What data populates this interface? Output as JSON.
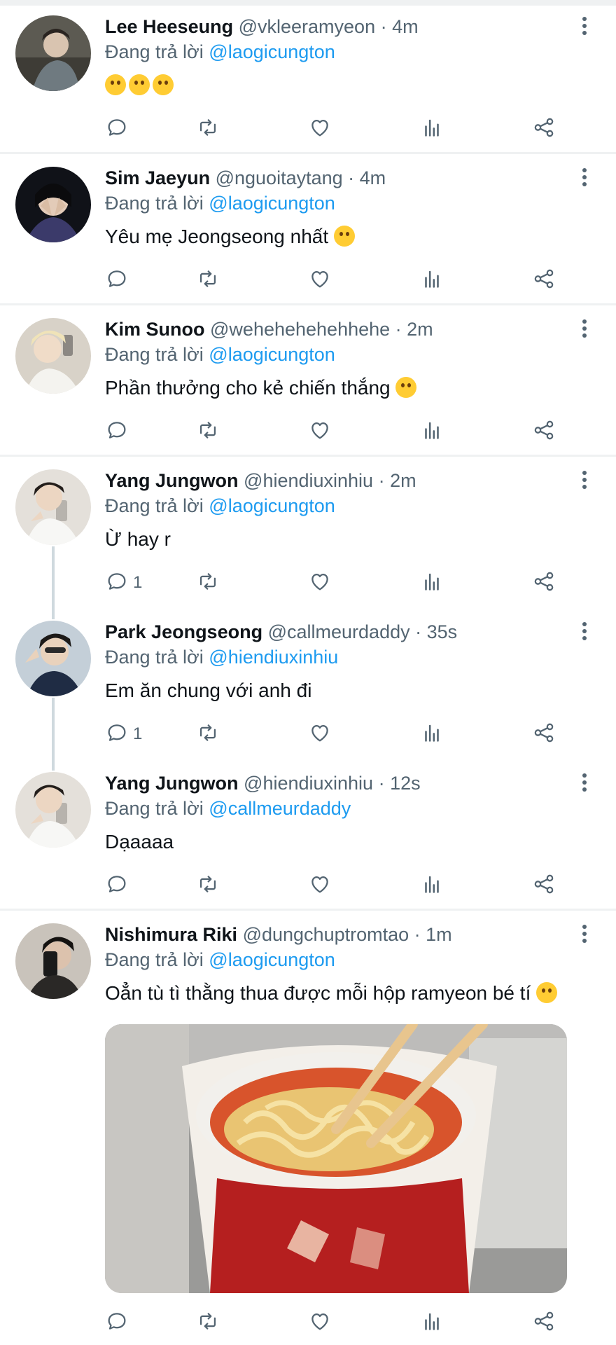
{
  "tweets": [
    {
      "name": "Lee Heeseung",
      "handle": "@vkleeramyeon",
      "time": "· 4m",
      "replying_prefix": "Đang trả lời",
      "replying_to": "@laogicungton",
      "text": "",
      "emoji_count": 3,
      "reply_count": ""
    },
    {
      "name": "Sim Jaeyun",
      "handle": "@nguoitaytang",
      "time": "· 4m",
      "replying_prefix": "Đang trả lời",
      "replying_to": "@laogicungton",
      "text": "Yêu mẹ Jeongseong nhất",
      "emoji_count": 1,
      "reply_count": ""
    },
    {
      "name": "Kim Sunoo",
      "handle": "@wehehehehehhehe",
      "time": "· 2m",
      "replying_prefix": "Đang trả lời",
      "replying_to": "@laogicungton",
      "text": "Phần thưởng cho kẻ chiến thắng",
      "emoji_count": 1,
      "reply_count": ""
    },
    {
      "name": "Yang Jungwon",
      "handle": "@hiendiuxinhiu",
      "time": "· 2m",
      "replying_prefix": "Đang trả lời",
      "replying_to": "@laogicungton",
      "text": "Ừ hay r",
      "emoji_count": 0,
      "reply_count": "1"
    },
    {
      "name": "Park Jeongseong",
      "handle": "@callmeurdaddy",
      "time": "· 35s",
      "replying_prefix": "Đang trả lời",
      "replying_to": "@hiendiuxinhiu",
      "text": "Em ăn chung với anh đi",
      "emoji_count": 0,
      "reply_count": "1"
    },
    {
      "name": "Yang Jungwon",
      "handle": "@hiendiuxinhiu",
      "time": "· 12s",
      "replying_prefix": "Đang trả lời",
      "replying_to": "@callmeurdaddy",
      "text": "Dạaaaa",
      "emoji_count": 0,
      "reply_count": ""
    },
    {
      "name": "Nishimura Riki",
      "handle": "@dungchuptromtao",
      "time": "· 1m",
      "replying_prefix": "Đang trả lời",
      "replying_to": "@laogicungton",
      "text": "Oẳn tù tì thằng thua được mỗi hộp ramyeon bé tí",
      "emoji_count": 1,
      "reply_count": ""
    }
  ],
  "action_icons": [
    "reply-icon",
    "retweet-icon",
    "like-icon",
    "analytics-icon",
    "share-icon"
  ],
  "colors": {
    "accent": "#1d9bf0",
    "muted": "#536471",
    "divider": "#eff1f2",
    "thread": "#cfd9de"
  }
}
